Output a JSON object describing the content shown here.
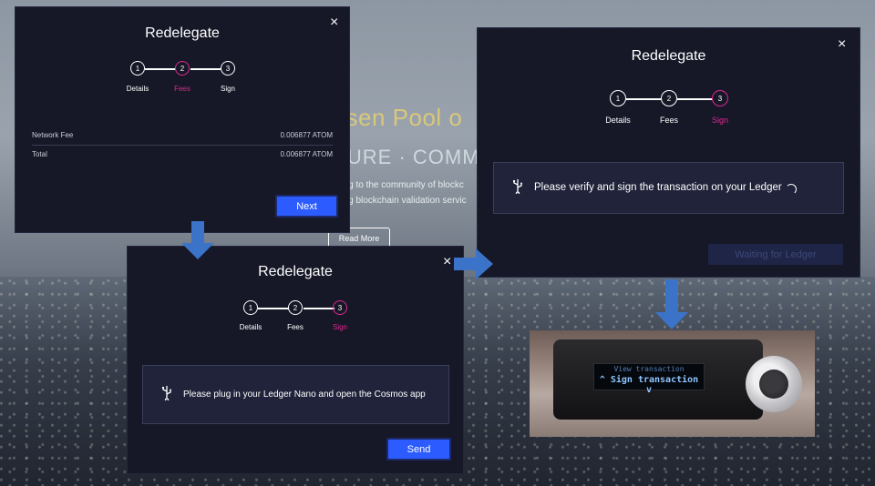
{
  "background": {
    "headline": "ysen Pool o",
    "subline": "CURE · COMM",
    "para1": "nting to the community of blockc",
    "para2": "ming blockchain validation servic",
    "read_more": "Read More"
  },
  "modal1": {
    "title": "Redelegate",
    "close": "×",
    "steps": [
      {
        "num": "1",
        "label": "Details",
        "active": false
      },
      {
        "num": "2",
        "label": "Fees",
        "active": true
      },
      {
        "num": "3",
        "label": "Sign",
        "active": false
      }
    ],
    "fees": [
      {
        "label": "Network Fee",
        "value": "0.006877 ATOM"
      },
      {
        "label": "Total",
        "value": "0.006877 ATOM"
      }
    ],
    "next_label": "Next"
  },
  "modal2": {
    "title": "Redelegate",
    "close": "×",
    "steps": [
      {
        "num": "1",
        "label": "Details",
        "active": false
      },
      {
        "num": "2",
        "label": "Fees",
        "active": false
      },
      {
        "num": "3",
        "label": "Sign",
        "active": true
      }
    ],
    "message": "Please plug in your Ledger Nano and open the Cosmos app",
    "send_label": "Send"
  },
  "modal3": {
    "title": "Redelegate",
    "close": "×",
    "steps": [
      {
        "num": "1",
        "label": "Details",
        "active": false
      },
      {
        "num": "2",
        "label": "Fees",
        "active": false
      },
      {
        "num": "3",
        "label": "Sign",
        "active": true
      }
    ],
    "message": "Please verify and sign the transaction on your Ledger",
    "waiting_label": "Waiting for Ledger"
  },
  "device": {
    "line1": "View transaction",
    "line2": "^ Sign transaction v"
  },
  "colors": {
    "modal_bg": "#161827",
    "accent_pink": "#e0288f",
    "button_blue": "#2c5cff",
    "arrow_blue": "#3b73c8"
  },
  "icons": {
    "usb": "usb-icon",
    "close": "close-icon",
    "arrow": "arrow-icon"
  }
}
